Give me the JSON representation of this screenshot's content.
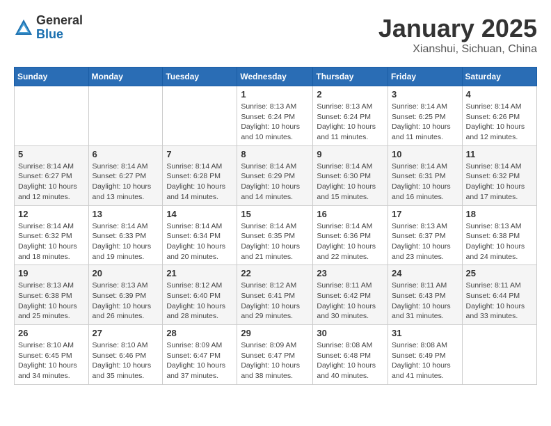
{
  "header": {
    "logo_general": "General",
    "logo_blue": "Blue",
    "title": "January 2025",
    "location": "Xianshui, Sichuan, China"
  },
  "weekdays": [
    "Sunday",
    "Monday",
    "Tuesday",
    "Wednesday",
    "Thursday",
    "Friday",
    "Saturday"
  ],
  "weeks": [
    [
      {
        "day": "",
        "info": ""
      },
      {
        "day": "",
        "info": ""
      },
      {
        "day": "",
        "info": ""
      },
      {
        "day": "1",
        "info": "Sunrise: 8:13 AM\nSunset: 6:24 PM\nDaylight: 10 hours\nand 10 minutes."
      },
      {
        "day": "2",
        "info": "Sunrise: 8:13 AM\nSunset: 6:24 PM\nDaylight: 10 hours\nand 11 minutes."
      },
      {
        "day": "3",
        "info": "Sunrise: 8:14 AM\nSunset: 6:25 PM\nDaylight: 10 hours\nand 11 minutes."
      },
      {
        "day": "4",
        "info": "Sunrise: 8:14 AM\nSunset: 6:26 PM\nDaylight: 10 hours\nand 12 minutes."
      }
    ],
    [
      {
        "day": "5",
        "info": "Sunrise: 8:14 AM\nSunset: 6:27 PM\nDaylight: 10 hours\nand 12 minutes."
      },
      {
        "day": "6",
        "info": "Sunrise: 8:14 AM\nSunset: 6:27 PM\nDaylight: 10 hours\nand 13 minutes."
      },
      {
        "day": "7",
        "info": "Sunrise: 8:14 AM\nSunset: 6:28 PM\nDaylight: 10 hours\nand 14 minutes."
      },
      {
        "day": "8",
        "info": "Sunrise: 8:14 AM\nSunset: 6:29 PM\nDaylight: 10 hours\nand 14 minutes."
      },
      {
        "day": "9",
        "info": "Sunrise: 8:14 AM\nSunset: 6:30 PM\nDaylight: 10 hours\nand 15 minutes."
      },
      {
        "day": "10",
        "info": "Sunrise: 8:14 AM\nSunset: 6:31 PM\nDaylight: 10 hours\nand 16 minutes."
      },
      {
        "day": "11",
        "info": "Sunrise: 8:14 AM\nSunset: 6:32 PM\nDaylight: 10 hours\nand 17 minutes."
      }
    ],
    [
      {
        "day": "12",
        "info": "Sunrise: 8:14 AM\nSunset: 6:32 PM\nDaylight: 10 hours\nand 18 minutes."
      },
      {
        "day": "13",
        "info": "Sunrise: 8:14 AM\nSunset: 6:33 PM\nDaylight: 10 hours\nand 19 minutes."
      },
      {
        "day": "14",
        "info": "Sunrise: 8:14 AM\nSunset: 6:34 PM\nDaylight: 10 hours\nand 20 minutes."
      },
      {
        "day": "15",
        "info": "Sunrise: 8:14 AM\nSunset: 6:35 PM\nDaylight: 10 hours\nand 21 minutes."
      },
      {
        "day": "16",
        "info": "Sunrise: 8:14 AM\nSunset: 6:36 PM\nDaylight: 10 hours\nand 22 minutes."
      },
      {
        "day": "17",
        "info": "Sunrise: 8:13 AM\nSunset: 6:37 PM\nDaylight: 10 hours\nand 23 minutes."
      },
      {
        "day": "18",
        "info": "Sunrise: 8:13 AM\nSunset: 6:38 PM\nDaylight: 10 hours\nand 24 minutes."
      }
    ],
    [
      {
        "day": "19",
        "info": "Sunrise: 8:13 AM\nSunset: 6:38 PM\nDaylight: 10 hours\nand 25 minutes."
      },
      {
        "day": "20",
        "info": "Sunrise: 8:13 AM\nSunset: 6:39 PM\nDaylight: 10 hours\nand 26 minutes."
      },
      {
        "day": "21",
        "info": "Sunrise: 8:12 AM\nSunset: 6:40 PM\nDaylight: 10 hours\nand 28 minutes."
      },
      {
        "day": "22",
        "info": "Sunrise: 8:12 AM\nSunset: 6:41 PM\nDaylight: 10 hours\nand 29 minutes."
      },
      {
        "day": "23",
        "info": "Sunrise: 8:11 AM\nSunset: 6:42 PM\nDaylight: 10 hours\nand 30 minutes."
      },
      {
        "day": "24",
        "info": "Sunrise: 8:11 AM\nSunset: 6:43 PM\nDaylight: 10 hours\nand 31 minutes."
      },
      {
        "day": "25",
        "info": "Sunrise: 8:11 AM\nSunset: 6:44 PM\nDaylight: 10 hours\nand 33 minutes."
      }
    ],
    [
      {
        "day": "26",
        "info": "Sunrise: 8:10 AM\nSunset: 6:45 PM\nDaylight: 10 hours\nand 34 minutes."
      },
      {
        "day": "27",
        "info": "Sunrise: 8:10 AM\nSunset: 6:46 PM\nDaylight: 10 hours\nand 35 minutes."
      },
      {
        "day": "28",
        "info": "Sunrise: 8:09 AM\nSunset: 6:47 PM\nDaylight: 10 hours\nand 37 minutes."
      },
      {
        "day": "29",
        "info": "Sunrise: 8:09 AM\nSunset: 6:47 PM\nDaylight: 10 hours\nand 38 minutes."
      },
      {
        "day": "30",
        "info": "Sunrise: 8:08 AM\nSunset: 6:48 PM\nDaylight: 10 hours\nand 40 minutes."
      },
      {
        "day": "31",
        "info": "Sunrise: 8:08 AM\nSunset: 6:49 PM\nDaylight: 10 hours\nand 41 minutes."
      },
      {
        "day": "",
        "info": ""
      }
    ]
  ]
}
